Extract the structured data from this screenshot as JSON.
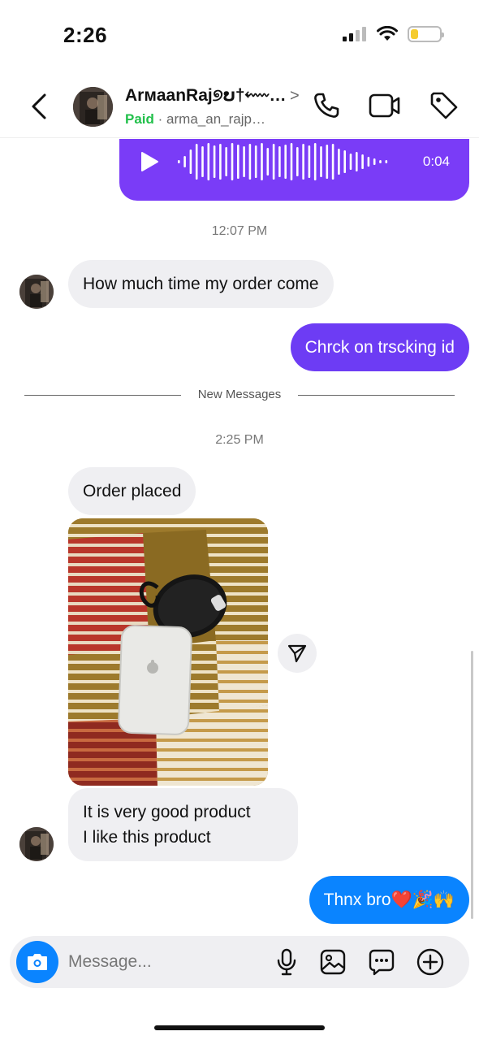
{
  "status_bar": {
    "time": "2:26",
    "battery_color": "#f5cc2f",
    "battery_level": 0.25
  },
  "header": {
    "name": "ArмaanRaj୭ບ†⬳…",
    "paid_label": "Paid",
    "separator": "·",
    "username": "arma_an_rajp…",
    "icons": [
      "back-icon",
      "call-icon",
      "video-call-icon",
      "tag-icon"
    ]
  },
  "thread": {
    "voice_message": {
      "duration": "0:04"
    },
    "timestamp_1": "12:07 PM",
    "msg_incoming_1": "How much time my order come",
    "msg_outgoing_1": "Chrck on trscking id",
    "divider_label": "New Messages",
    "timestamp_2": "2:25 PM",
    "msg_incoming_2": "Order placed",
    "msg_incoming_3_line1": "It is very good product",
    "msg_incoming_3_line2": "I like this product",
    "msg_outgoing_2": "Thnx bro❤️🎉🙌"
  },
  "composer": {
    "placeholder": "Message...",
    "icons": [
      "camera-icon",
      "microphone-icon",
      "gallery-icon",
      "sticker-icon",
      "add-icon"
    ]
  },
  "colors": {
    "outgoing_purple": "#6d3cf4",
    "voice_purple": "#7a3cf7",
    "outgoing_blue": "#0a84ff",
    "incoming_gray": "#efeff2",
    "paid_green": "#22c04b"
  }
}
